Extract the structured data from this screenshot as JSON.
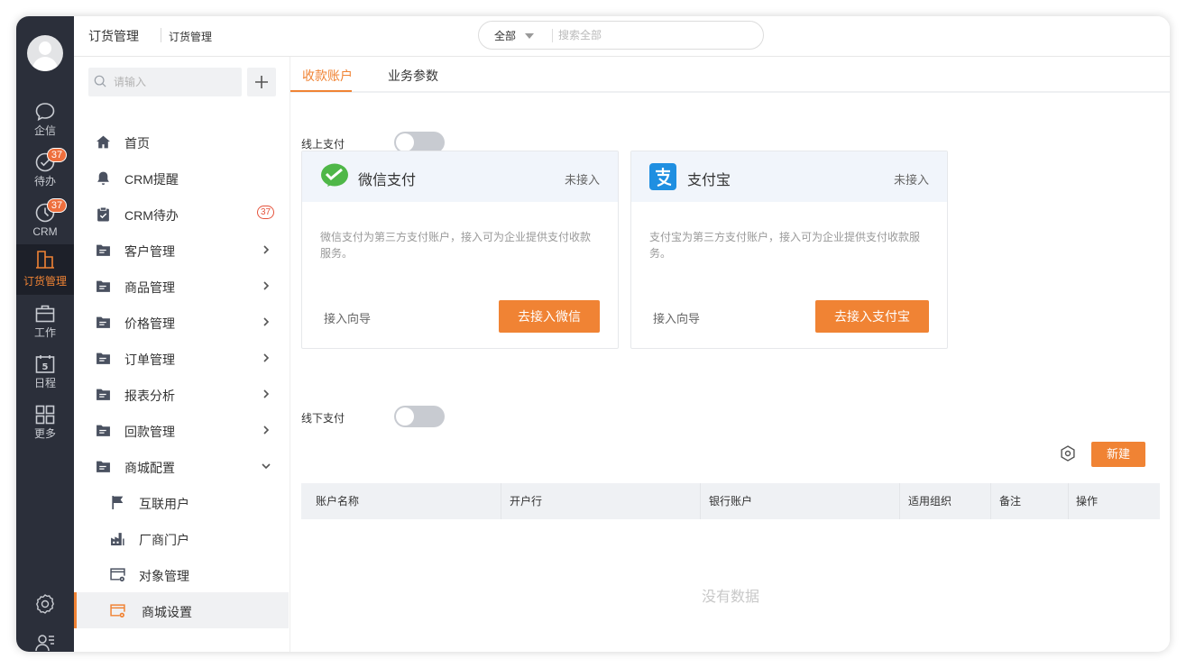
{
  "rail": {
    "items": [
      {
        "label": "企信",
        "icon": "chat-bubble-icon"
      },
      {
        "label": "待办",
        "icon": "check-circle-icon",
        "badge": "37"
      },
      {
        "label": "CRM",
        "icon": "clock-icon",
        "badge": "37"
      },
      {
        "label": "订货管理",
        "icon": "building-icon",
        "active": true
      },
      {
        "label": "工作",
        "icon": "briefcase-icon"
      },
      {
        "label": "日程",
        "icon": "calendar-icon",
        "day": "5"
      },
      {
        "label": "更多",
        "icon": "grid-icon"
      }
    ]
  },
  "header": {
    "breadcrumb_main": "订货管理",
    "breadcrumb_sub": "订货管理",
    "search_scope": "全部",
    "search_placeholder": "搜索全部"
  },
  "sidebar": {
    "search_placeholder": "请输入",
    "items": [
      {
        "label": "首页",
        "icon": "home-icon"
      },
      {
        "label": "CRM提醒",
        "icon": "bell-icon"
      },
      {
        "label": "CRM待办",
        "icon": "clipboard-check-icon",
        "badge": "37"
      },
      {
        "label": "客户管理",
        "icon": "folder-icon",
        "expandable": true
      },
      {
        "label": "商品管理",
        "icon": "folder-icon",
        "expandable": true
      },
      {
        "label": "价格管理",
        "icon": "folder-icon",
        "expandable": true
      },
      {
        "label": "订单管理",
        "icon": "folder-icon",
        "expandable": true
      },
      {
        "label": "报表分析",
        "icon": "folder-icon",
        "expandable": true
      },
      {
        "label": "回款管理",
        "icon": "folder-icon",
        "expandable": true
      },
      {
        "label": "商城配置",
        "icon": "folder-icon",
        "expanded": true
      }
    ],
    "sub_items": [
      {
        "label": "互联用户",
        "icon": "flag-icon"
      },
      {
        "label": "厂商门户",
        "icon": "factory-icon"
      },
      {
        "label": "对象管理",
        "icon": "window-gear-icon"
      },
      {
        "label": "商城设置",
        "icon": "store-gear-icon",
        "active": true
      }
    ]
  },
  "content": {
    "tabs": [
      {
        "label": "收款账户",
        "active": true
      },
      {
        "label": "业务参数"
      }
    ],
    "online": {
      "label": "线上支付",
      "enabled": false,
      "cards": [
        {
          "name": "微信支付",
          "status": "未接入",
          "desc": "微信支付为第三方支付账户，接入可为企业提供支付收款服务。",
          "guide": "接入向导",
          "button": "去接入微信",
          "icon": "wechat-pay-icon"
        },
        {
          "name": "支付宝",
          "status": "未接入",
          "desc": "支付宝为第三方支付账户，接入可为企业提供支付收款服务。",
          "guide": "接入向导",
          "button": "去接入支付宝",
          "icon": "alipay-icon"
        }
      ]
    },
    "offline": {
      "label": "线下支付",
      "enabled": false
    },
    "new_button": "新建",
    "table": {
      "columns": [
        "账户名称",
        "开户行",
        "银行账户",
        "适用组织",
        "备注",
        "操作"
      ],
      "rows": [],
      "empty_text": "没有数据"
    }
  },
  "colors": {
    "accent": "#f08334",
    "rail_bg": "#2b2f3a",
    "badge": "#ee6f3d",
    "wechat": "#4fb748",
    "alipay": "#1f8fe1"
  }
}
